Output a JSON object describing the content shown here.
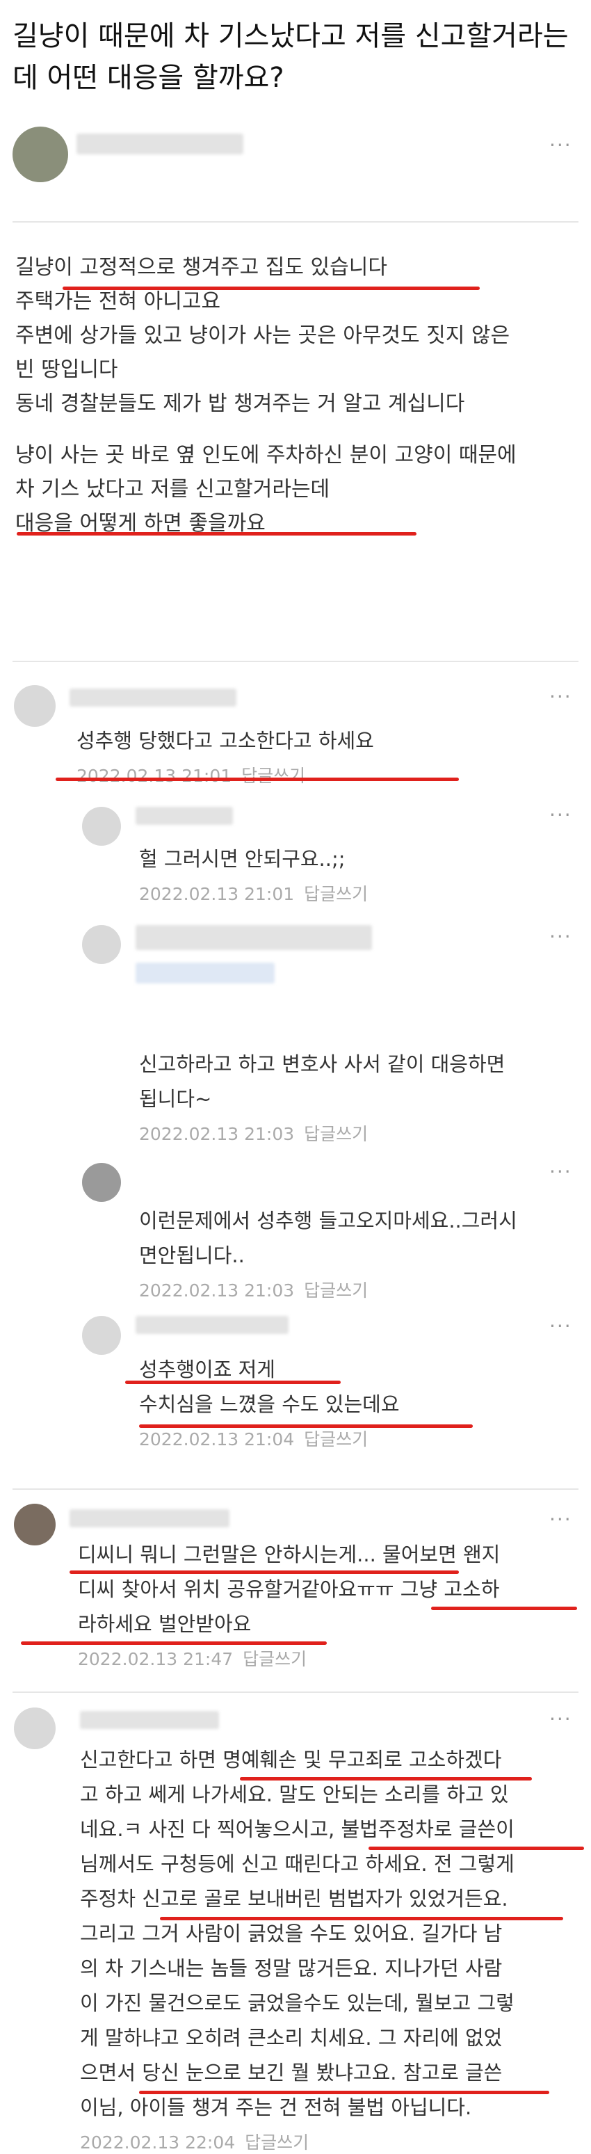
{
  "post": {
    "title": "길냥이 때문에 차 기스났다고 저를 신고할거라는데 어떤 대응을 할까요?",
    "body": [
      "길냥이 고정적으로 챙겨주고 집도 있습니다",
      "주택가는 전혀 아니고요",
      "주변에 상가들 있고 냥이가 사는 곳은 아무것도 짓지 않은",
      "빈 땅입니다",
      "동네 경찰분들도 제가 밥 챙겨주는 거 알고 계십니다",
      "",
      "냥이 사는 곳 바로 옆 인도에 주차하신 분이 고양이 때문에",
      "차 기스 났다고 저를 신고할거라는데",
      "대응을 어떻게 하면 좋을까요"
    ]
  },
  "reply_label": "답글쓰기",
  "more_label": "···",
  "comments": [
    {
      "lines": [
        "성추행 당했다고 고소한다고 하세요"
      ],
      "date": "2022.02.13 21:01"
    },
    {
      "lines": [
        "헐 그러시면 안되구요..;;"
      ],
      "date": "2022.02.13 21:01"
    },
    {
      "lines": [
        "신고하라고 하고 변호사 사서 같이 대응하면",
        "됩니다~"
      ],
      "date": "2022.02.13 21:03"
    },
    {
      "lines": [
        "이런문제에서 성추행 들고오지마세요..그러시",
        "면안됩니다.."
      ],
      "date": "2022.02.13 21:03"
    },
    {
      "lines": [
        "성추행이죠 저게",
        "수치심을 느꼈을 수도 있는데요"
      ],
      "date": "2022.02.13 21:04"
    },
    {
      "lines": [
        "디씨니 뭐니 그런말은 안하시는게... 물어보면 왠지",
        "디씨 찾아서 위치 공유할거같아요ㅠㅠ 그냥 고소하",
        "라하세요 벌안받아요"
      ],
      "date": "2022.02.13 21:47"
    },
    {
      "lines": [
        "신고한다고 하면 명예훼손 및 무고죄로 고소하겠다",
        "고 하고 쎄게 나가세요. 말도 안되는 소리를 하고 있",
        "네요.ㅋ 사진 다 찍어놓으시고, 불법주정차로 글쓴이",
        "님께서도 구청등에 신고 때린다고 하세요. 전 그렇게",
        "주정차 신고로 골로 보내버린 범법자가 있었거든요.",
        "그리고 그거 사람이 긁었을 수도 있어요. 길가다 남",
        "의 차 기스내는 놈들 정말 많거든요. 지나가던 사람",
        "이 가진 물건으로도 긁었을수도 있는데, 뭘보고 그렇",
        "게 말하냐고 오히려 큰소리 치세요. 그 자리에 없었",
        "으면서 당신 눈으로 보긴 뭘 봤냐고요. 참고로 글쓴",
        "이님, 아이들 챙겨 주는 건 전혀 불법 아닙니다."
      ],
      "date": "2022.02.13 22:04"
    }
  ]
}
